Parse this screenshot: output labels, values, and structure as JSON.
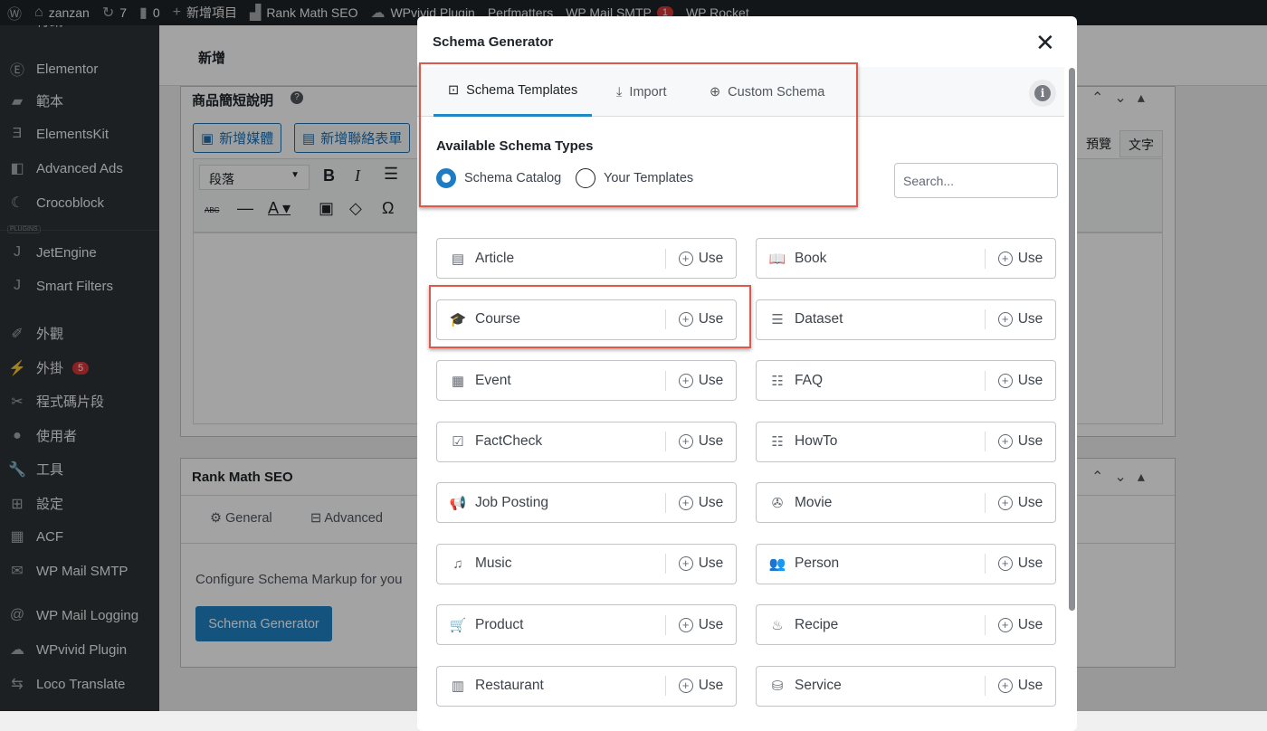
{
  "adminbar": {
    "items": [
      {
        "icon": "wordpress-icon",
        "label": ""
      },
      {
        "icon": "home-icon",
        "label": "zanzan"
      },
      {
        "icon": "updates-icon",
        "label": "7"
      },
      {
        "icon": "comments-icon",
        "label": "0"
      },
      {
        "icon": "plus-icon",
        "label": "新增項目"
      },
      {
        "icon": "rank-math-icon",
        "label": "Rank Math SEO"
      },
      {
        "icon": "cloud-icon",
        "label": "WPvivid Plugin"
      },
      {
        "icon": "",
        "label": "Perfmatters"
      },
      {
        "icon": "",
        "label": "WP Mail SMTP",
        "badge": "1"
      },
      {
        "icon": "",
        "label": "WP Rocket"
      }
    ]
  },
  "sidebar": {
    "plugins_label": "PLUGINS",
    "items": [
      {
        "icon": "megaphone-icon",
        "glyph": "✎",
        "label": "行銷"
      },
      {
        "icon": "elementor-icon",
        "glyph": "Ⓔ",
        "label": "Elementor"
      },
      {
        "icon": "folder-icon",
        "glyph": "▰",
        "label": "範本"
      },
      {
        "icon": "elementskit-icon",
        "glyph": "Ǝ",
        "label": "ElementsKit"
      },
      {
        "icon": "advanced-ads-icon",
        "glyph": "◧",
        "label": "Advanced Ads"
      },
      {
        "icon": "crocoblock-icon",
        "glyph": "☾",
        "label": "Crocoblock"
      },
      {
        "icon": "jet-icon",
        "glyph": "J",
        "label": "JetEngine"
      },
      {
        "icon": "jet-icon",
        "glyph": "J",
        "label": "Smart Filters"
      },
      {
        "icon": "brush-icon",
        "glyph": "✐",
        "label": "外觀"
      },
      {
        "icon": "plugin-icon",
        "glyph": "⚡",
        "label": "外掛",
        "badge": "5"
      },
      {
        "icon": "snippets-icon",
        "glyph": "✂",
        "label": "程式碼片段"
      },
      {
        "icon": "user-icon",
        "glyph": "●",
        "label": "使用者"
      },
      {
        "icon": "wrench-icon",
        "glyph": "🔧",
        "label": "工具"
      },
      {
        "icon": "settings-icon",
        "glyph": "⊞",
        "label": "設定"
      },
      {
        "icon": "acf-icon",
        "glyph": "▦",
        "label": "ACF"
      },
      {
        "icon": "mail-icon",
        "glyph": "✉",
        "label": "WP Mail SMTP"
      },
      {
        "icon": "at-icon",
        "glyph": "@",
        "label": "WP Mail Logging"
      },
      {
        "icon": "cloud-icon",
        "glyph": "☁",
        "label": "WPvivid Plugin"
      },
      {
        "icon": "translate-icon",
        "glyph": "⇆",
        "label": "Loco Translate"
      }
    ]
  },
  "page": {
    "title": "新增",
    "excerpt_box": {
      "title": "商品簡短說明",
      "add_media": "新增媒體",
      "add_form": "新增聯絡表單",
      "format_select": "段落",
      "tab_visual": "預覽",
      "tab_text": "文字"
    },
    "rankmath_box": {
      "title": "Rank Math SEO",
      "tab_general": "General",
      "tab_advanced": "Advanced",
      "description": "Configure Schema Markup for you",
      "button": "Schema Generator"
    }
  },
  "modal": {
    "title": "Schema Generator",
    "tabs": [
      {
        "icon": "template-icon",
        "label": "Schema Templates",
        "active": true
      },
      {
        "icon": "import-icon",
        "label": "Import"
      },
      {
        "icon": "plus-circle-icon",
        "label": "Custom Schema"
      }
    ],
    "section_title": "Available Schema Types",
    "radios": [
      {
        "label": "Schema Catalog",
        "checked": true
      },
      {
        "label": "Your Templates",
        "checked": false
      }
    ],
    "search_placeholder": "Search...",
    "use_label": "Use",
    "highlight_color": "#e0584a",
    "accent_color": "#1e88c8",
    "schemas": [
      {
        "name": "Article",
        "icon": "article-icon",
        "glyph": "▤"
      },
      {
        "name": "Book",
        "icon": "book-icon",
        "glyph": "📖"
      },
      {
        "name": "Course",
        "icon": "graduation-cap-icon",
        "glyph": "🎓",
        "highlighted": true
      },
      {
        "name": "Dataset",
        "icon": "database-icon",
        "glyph": "☰"
      },
      {
        "name": "Event",
        "icon": "calendar-icon",
        "glyph": "▦"
      },
      {
        "name": "FAQ",
        "icon": "list-icon",
        "glyph": "☷"
      },
      {
        "name": "FactCheck",
        "icon": "check-comment-icon",
        "glyph": "☑"
      },
      {
        "name": "HowTo",
        "icon": "list-icon",
        "glyph": "☷"
      },
      {
        "name": "Job Posting",
        "icon": "megaphone-icon",
        "glyph": "📢"
      },
      {
        "name": "Movie",
        "icon": "film-icon",
        "glyph": "✇"
      },
      {
        "name": "Music",
        "icon": "music-icon",
        "glyph": "♫"
      },
      {
        "name": "Person",
        "icon": "people-icon",
        "glyph": "👥"
      },
      {
        "name": "Product",
        "icon": "cart-icon",
        "glyph": "🛒"
      },
      {
        "name": "Recipe",
        "icon": "chef-hat-icon",
        "glyph": "♨"
      },
      {
        "name": "Restaurant",
        "icon": "store-icon",
        "glyph": "▥"
      },
      {
        "name": "Service",
        "icon": "service-icon",
        "glyph": "⛁"
      }
    ]
  }
}
